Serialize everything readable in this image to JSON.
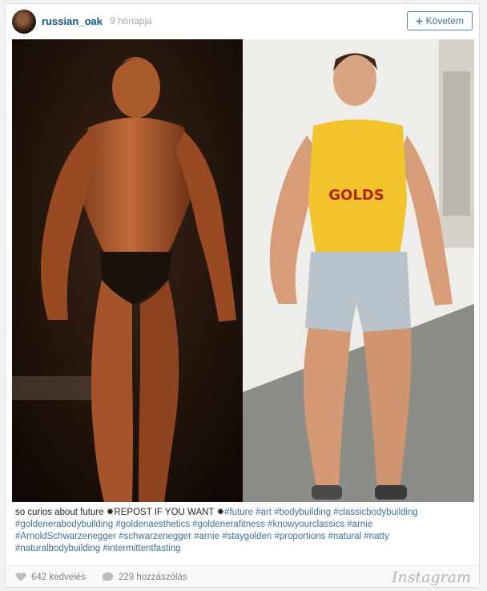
{
  "post": {
    "username": "russian_oak",
    "separator": "•",
    "timestamp": "9 hónapja",
    "follow_label": "Követem",
    "follow_icon": "plus-icon"
  },
  "caption": {
    "text": "so curios about future ",
    "emphasis": "✸REPOST IF YOU WANT ✸",
    "tags": "#future #art #bodybuilding #classicbodybuilding #goldenerabodybuilding #goldenaesthetics #goldenerafitness #knowyourclassics #arnie #ArnoldSchwarzenegger #schwarzenegger #arnie #staygolden #proportions #natural #natty #naturalbodybuilding #intermittentfasting"
  },
  "stats": {
    "likes": "642 kedvelés",
    "comments": "229 hozzászólás",
    "logo": "Instagram"
  },
  "colors": {
    "username": "#125688",
    "link": "#3f729b",
    "muted": "#a5a7aa"
  }
}
